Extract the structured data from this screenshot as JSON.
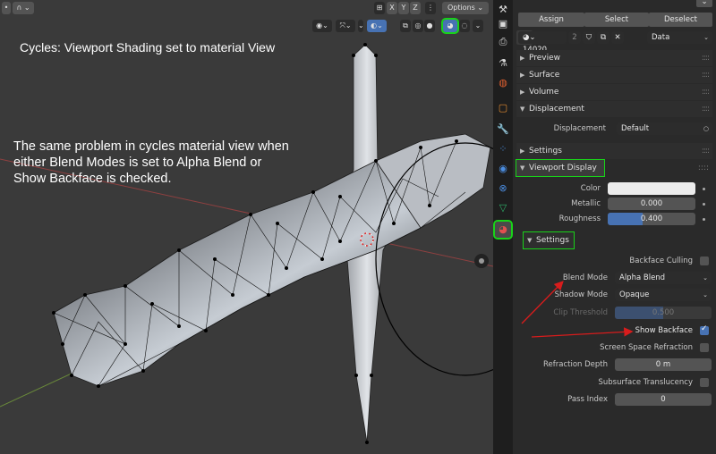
{
  "viewport": {
    "header": {
      "axis_labels": [
        "X",
        "Y",
        "Z"
      ],
      "options_label": "Options"
    },
    "annotations": {
      "title": "Cycles: Viewport Shading set to material View",
      "description_lines": [
        "The same problem in cycles material view when",
        "either Blend Modes is set to Alpha Blend or",
        "Show Backface is checked."
      ]
    }
  },
  "properties": {
    "actions": {
      "assign": "Assign",
      "select": "Select",
      "deselect": "Deselect"
    },
    "material_slot": {
      "name": "14020_...",
      "users": "2",
      "link": "Data"
    },
    "panels": {
      "preview": "Preview",
      "surface": "Surface",
      "volume": "Volume",
      "displacement": "Displacement",
      "settings": "Settings",
      "viewport_display": "Viewport Display",
      "settings_sub": "Settings"
    },
    "displacement": {
      "label": "Displacement",
      "value": "Default"
    },
    "viewport_display": {
      "color_label": "Color",
      "metallic_label": "Metallic",
      "metallic_value": "0.000",
      "roughness_label": "Roughness",
      "roughness_value": "0.400",
      "roughness_fraction": 0.4
    },
    "settings": {
      "backface_culling_label": "Backface Culling",
      "backface_culling": false,
      "blend_mode_label": "Blend Mode",
      "blend_mode_value": "Alpha Blend",
      "shadow_mode_label": "Shadow Mode",
      "shadow_mode_value": "Opaque",
      "clip_threshold_label": "Clip Threshold",
      "clip_threshold_value": "0.500",
      "clip_fraction": 0.5,
      "show_backface_label": "Show Backface",
      "show_backface": true,
      "ssr_label": "Screen Space Refraction",
      "ssr": false,
      "refraction_depth_label": "Refraction Depth",
      "refraction_depth_value": "0 m",
      "subsurface_label": "Subsurface Translucency",
      "subsurface": false,
      "pass_index_label": "Pass Index",
      "pass_index_value": "0"
    }
  },
  "colors": {
    "highlight": "#19d219",
    "accent": "#4772b3",
    "annotation_arrow": "#d81c1c"
  }
}
